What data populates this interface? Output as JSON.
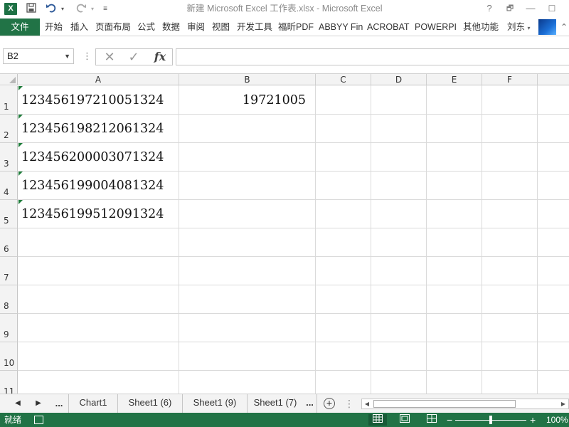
{
  "titlebar": {
    "title": "新建 Microsoft Excel 工作表.xlsx - Microsoft Excel",
    "app_logo": "X",
    "help": "?",
    "ribbon_display": "🗗",
    "minimize": "—",
    "maximize": "☐"
  },
  "quick_access": {
    "save_icon": "save-icon",
    "undo_icon": "undo-icon",
    "redo_icon": "redo-icon"
  },
  "ribbon": {
    "file_label": "文件",
    "tabs": [
      "开始",
      "插入",
      "页面布局",
      "公式",
      "数据",
      "审阅",
      "视图",
      "开发工具",
      "福昕PDF",
      "ABBYY Fin",
      "ACROBAT",
      "POWERPI",
      "其他功能"
    ],
    "user_name": "刘东"
  },
  "formula_bar": {
    "name_box": "B2",
    "cancel_glyph": "✕",
    "enter_glyph": "✓",
    "function_glyph": "fx",
    "formula_value": ""
  },
  "grid": {
    "columns": [
      "A",
      "B",
      "C",
      "D",
      "E",
      "F"
    ],
    "rows": [
      "1",
      "2",
      "3",
      "4",
      "5",
      "6",
      "7",
      "8",
      "9",
      "10",
      "11"
    ],
    "cells": {
      "A1": "123456197210051324",
      "A2": "123456198212061324",
      "A3": "123456200003071324",
      "A4": "123456199004081324",
      "A5": "123456199512091324",
      "B1": "19721005"
    }
  },
  "sheet_tabs": {
    "more": "...",
    "tabs": [
      "Chart1",
      "Sheet1 (6)",
      "Sheet1 (9)",
      "Sheet1 (7)",
      "..."
    ],
    "add": "+"
  },
  "status_bar": {
    "status": "就绪",
    "zoom": "100%",
    "zoom_minus": "−",
    "zoom_plus": "+"
  },
  "colors": {
    "accent": "#217346",
    "error_indicator": "#1e7c3a"
  }
}
